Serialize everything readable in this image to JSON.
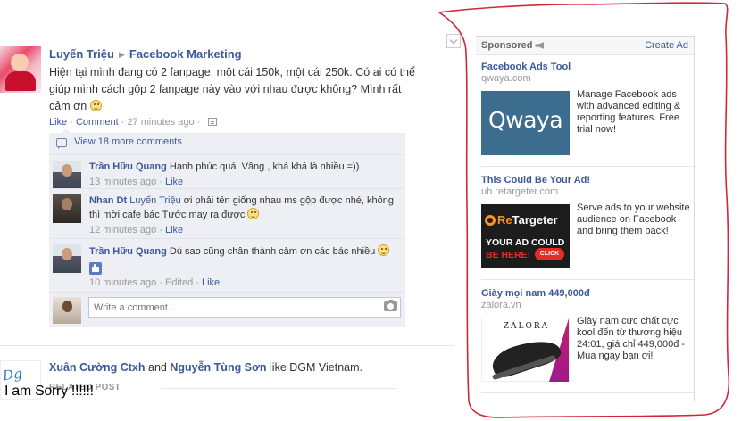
{
  "post": {
    "author": "Luyến Triệu",
    "target": "Facebook Marketing",
    "text": "Hiện tại mình đang có 2 fanpage, một cái 150k, một cái 250k. Có ai có thể giúp mình cách gộp 2 fanpage này vào với nhau được không? Mình rất cảm ơn",
    "like_label": "Like",
    "comment_label": "Comment",
    "time": "27 minutes ago"
  },
  "comments": {
    "view_more": "View 18 more comments",
    "items": [
      {
        "author": "Trần Hữu Quang",
        "text": "Hạnh phúc quá. Vâng , khá khá là nhiều =))",
        "time": "13 minutes ago",
        "like_label": "Like"
      },
      {
        "author": "Nhan Dt",
        "mention": "Luyến Triệu",
        "text": "ơi phải tên giống nhau ms gộp được nhé, không thì mời cafe bác Tước may ra được",
        "time": "12 minutes ago",
        "like_label": "Like"
      },
      {
        "author": "Trần Hữu Quang",
        "text": "Dù sao cũng chân thành cảm ơn các bác nhiều",
        "time": "10 minutes ago",
        "edited_label": "Edited",
        "like_label": "Like"
      }
    ],
    "write_placeholder": "Write a comment..."
  },
  "story": {
    "actor1": "Xuân Cường Ctxh",
    "and_word": "and",
    "actor2": "Nguyễn Tùng Sơn",
    "verb": "like",
    "page": "DGM Vietnam.",
    "related_label": "RELATED POST",
    "overlay_text": "I am Sorry !!!!!!"
  },
  "sidebar": {
    "sponsored_label": "Sponsored",
    "create_ad_label": "Create Ad",
    "ads": [
      {
        "title": "Facebook Ads Tool",
        "domain": "qwaya.com",
        "image_text": "Qwaya",
        "body": "Manage Facebook ads with advanced editing & reporting features. Free trial now!"
      },
      {
        "title": "This Could Be Your Ad!",
        "domain": "ub.retargeter.com",
        "image_logo_a": "Re",
        "image_logo_b": "Targeter",
        "image_line1": "YOUR AD COULD",
        "image_line2": "BE HERE!",
        "image_button": "CLICK",
        "body": "Serve ads to your website audience on Facebook and bring them back!"
      },
      {
        "title": "Giày mọi nam 449,000đ",
        "domain": "zalora.vn",
        "image_logo": "ZALORA",
        "body": "Giày nam cực chất cực kool đến từ thương hiệu 24:01, giá chỉ 449,000đ - Mua ngay bạn ơi!"
      }
    ]
  },
  "colors": {
    "link": "#3b5998",
    "comment_bg": "#edeff4",
    "annotation": "#d0283a"
  }
}
